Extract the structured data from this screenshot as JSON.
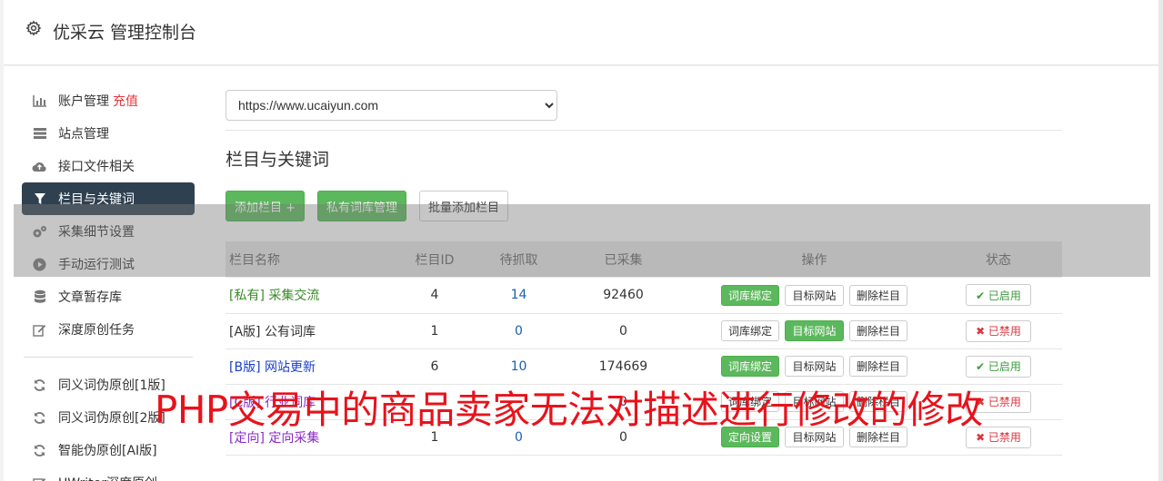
{
  "header": {
    "title": "优采云 管理控制台",
    "icon": "gear-icon"
  },
  "sidebar": {
    "items": [
      {
        "label": "账户管理",
        "extra": "充值",
        "icon": "bar-chart-icon"
      },
      {
        "label": "站点管理",
        "icon": "server-icon"
      },
      {
        "label": "接口文件相关",
        "icon": "cloud-upload-icon"
      },
      {
        "label": "栏目与关键词",
        "icon": "filter-icon",
        "active": true
      },
      {
        "label": "采集细节设置",
        "icon": "cogs-icon"
      },
      {
        "label": "手动运行测试",
        "icon": "play-circle-icon"
      },
      {
        "label": "文章暂存库",
        "icon": "database-icon"
      },
      {
        "label": "深度原创任务",
        "icon": "edit-icon"
      }
    ],
    "items2": [
      {
        "label": "同义词伪原创[1版]",
        "icon": "refresh-icon"
      },
      {
        "label": "同义词伪原创[2版]",
        "icon": "refresh-icon"
      },
      {
        "label": "智能伪原创[AI版]",
        "icon": "refresh-icon"
      },
      {
        "label": "UWriter深度原创",
        "icon": "edit-icon"
      }
    ]
  },
  "main": {
    "site_select": "https://www.ucaiyun.com",
    "section_title": "栏目与关键词",
    "buttons": {
      "add_column": "添加栏目 +",
      "private_lib": "私有词库管理",
      "batch_add": "批量添加栏目"
    },
    "table": {
      "headers": [
        "栏目名称",
        "栏目ID",
        "待抓取",
        "已采集",
        "操作",
        "状态"
      ],
      "rows": [
        {
          "tag": "[私有]",
          "name": "采集交流",
          "id": "4",
          "pending": "14",
          "collected": "92460",
          "op1": "词库绑定",
          "op2": "目标网站",
          "op3": "删除栏目",
          "status": "✔ 已启用"
        },
        {
          "tag": "[A版]",
          "name": "公有词库",
          "id": "1",
          "pending": "0",
          "collected": "0",
          "op1": "词库绑定",
          "op2": "目标网站",
          "op3": "删除栏目",
          "status": "✖ 已禁用"
        },
        {
          "tag": "[B版]",
          "name": "网站更新",
          "id": "6",
          "pending": "10",
          "collected": "174669",
          "op1": "词库绑定",
          "op2": "目标网站",
          "op3": "删除栏目",
          "status": "✔ 已启用"
        },
        {
          "tag": "[C版]",
          "name": "行业词库",
          "id": "",
          "pending": "",
          "collected": "0",
          "op1": "词库绑定",
          "op2": "目标网站",
          "op3": "删除栏目",
          "status": "✖ 已禁用"
        },
        {
          "tag": "[定向]",
          "name": "定向采集",
          "id": "1",
          "pending": "0",
          "collected": "0",
          "op1": "定向设置",
          "op2": "目标网站",
          "op3": "删除栏目",
          "status": "✖ 已禁用"
        }
      ]
    }
  },
  "watermark": "PHP交易中的商品卖家无法对描述进行修改的修改",
  "colors": {
    "accent_green": "#5cb85c",
    "nav_active": "#2f4050",
    "watermark_red": "#e8121b"
  }
}
